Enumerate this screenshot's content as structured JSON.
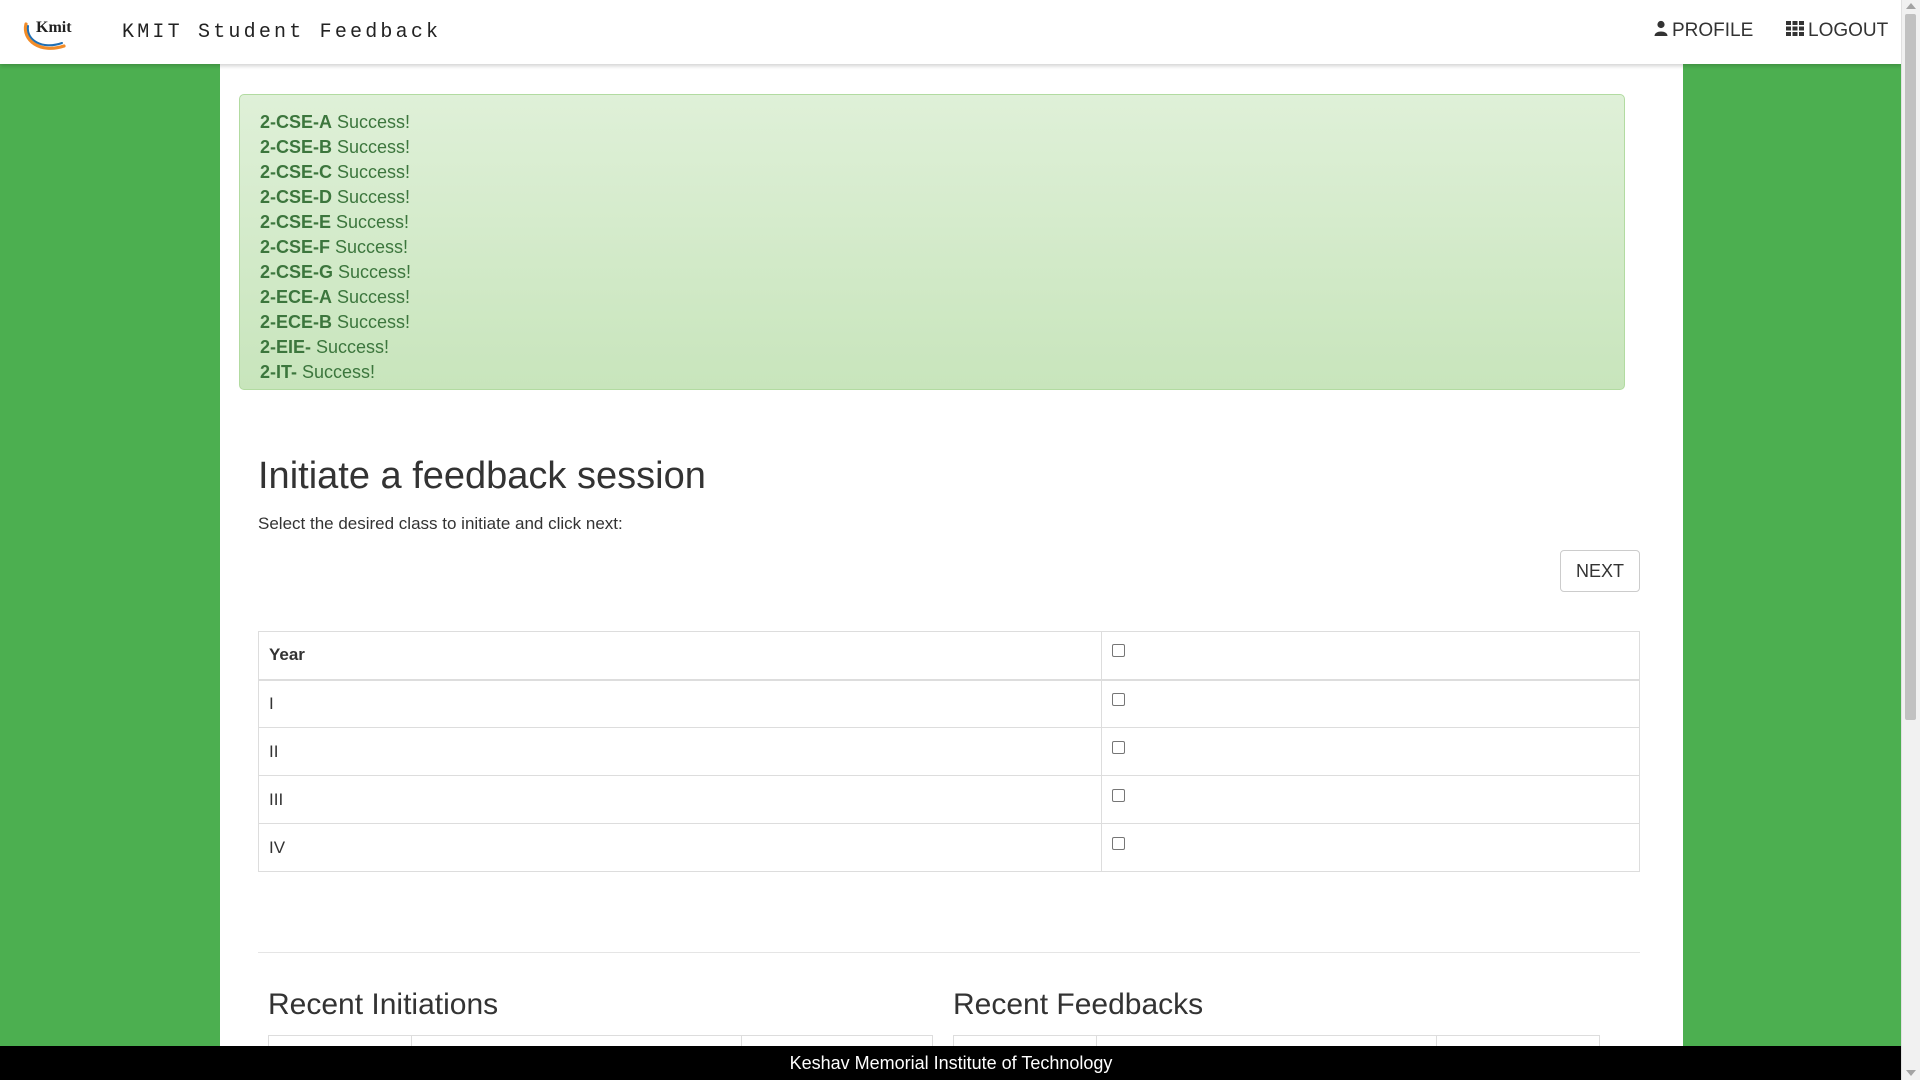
{
  "navbar": {
    "brand": "KMIT Student Feedback",
    "logo_text": "Kmit",
    "profile_label": "PROFILE",
    "logout_label": "LOGOUT",
    "profile_icon": "user-icon",
    "logout_icon": "grid-icon"
  },
  "alert": {
    "items": [
      {
        "section": "2-CSE-A",
        "status": "Success!"
      },
      {
        "section": "2-CSE-B",
        "status": "Success!"
      },
      {
        "section": "2-CSE-C",
        "status": "Success!"
      },
      {
        "section": "2-CSE-D",
        "status": "Success!"
      },
      {
        "section": "2-CSE-E",
        "status": "Success!"
      },
      {
        "section": "2-CSE-F",
        "status": "Success!"
      },
      {
        "section": "2-CSE-G",
        "status": "Success!"
      },
      {
        "section": "2-ECE-A",
        "status": "Success!"
      },
      {
        "section": "2-ECE-B",
        "status": "Success!"
      },
      {
        "section": "2-EIE-",
        "status": "Success!"
      },
      {
        "section": "2-IT-",
        "status": "Success!"
      }
    ]
  },
  "main": {
    "title": "Initiate a feedback session",
    "subtitle": "Select the desired class to initiate and click next:",
    "next_label": "NEXT",
    "table": {
      "header": "Year",
      "rows": [
        {
          "year": "I",
          "checked": false
        },
        {
          "year": "II",
          "checked": false
        },
        {
          "year": "III",
          "checked": false
        },
        {
          "year": "IV",
          "checked": false
        }
      ]
    }
  },
  "recent": {
    "initiations_title": "Recent Initiations",
    "feedbacks_title": "Recent Feedbacks"
  },
  "footer": {
    "text": "Keshav Memorial Institute of Technology"
  },
  "colors": {
    "page_background": "#4caf50",
    "alert_background": "#dff0d8",
    "alert_text": "#3c763d",
    "footer_background": "#000000",
    "logo_orange": "#f28c28",
    "logo_blue": "#1f6fb4"
  }
}
